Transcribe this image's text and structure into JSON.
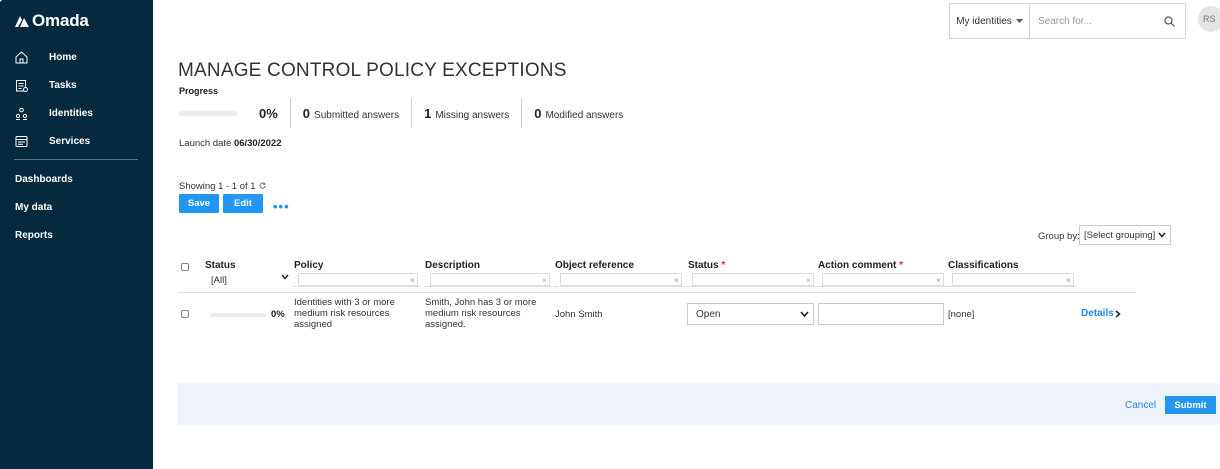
{
  "app": {
    "logo_text": "Omada"
  },
  "sidebar": {
    "items": [
      {
        "label": "Home",
        "icon": "home-icon"
      },
      {
        "label": "Tasks",
        "icon": "tasks-icon"
      },
      {
        "label": "Identities",
        "icon": "identities-icon"
      },
      {
        "label": "Services",
        "icon": "services-icon"
      }
    ],
    "links": [
      {
        "label": "Dashboards"
      },
      {
        "label": "My data"
      },
      {
        "label": "Reports"
      }
    ]
  },
  "topbar": {
    "identity_select": "My identities",
    "search_placeholder": "Search for...",
    "avatar_initials": "RS"
  },
  "page": {
    "title": "MANAGE CONTROL POLICY EXCEPTIONS",
    "progress_label": "Progress",
    "progress_percent_text": "0%",
    "progress_value": 0,
    "stats": [
      {
        "num": "0",
        "label": "Submitted answers"
      },
      {
        "num": "1",
        "label": "Missing answers"
      },
      {
        "num": "0",
        "label": "Modified answers"
      }
    ],
    "launch_label": "Launch date",
    "launch_date": "06/30/2022"
  },
  "toolbar": {
    "showing": "Showing 1 - 1 of 1",
    "save_label": "Save",
    "edit_label": "Edit",
    "more_label": "•••",
    "groupby_label": "Group by:",
    "groupby_value": "[Select grouping]"
  },
  "table": {
    "columns": [
      {
        "label": "Status",
        "required": false
      },
      {
        "label": "Policy",
        "required": false
      },
      {
        "label": "Description",
        "required": false
      },
      {
        "label": "Object reference",
        "required": false
      },
      {
        "label": "Status",
        "required": true
      },
      {
        "label": "Action comment",
        "required": true
      },
      {
        "label": "Classifications",
        "required": false
      }
    ],
    "status_filter": "[All]",
    "rows": [
      {
        "progress_text": "0%",
        "progress_value": 0,
        "policy": "Identities with 3 or more medium risk resources assigned",
        "description": "Smith, John has 3 or more medium risk resources assigned.",
        "object_reference": "John Smith",
        "status": "Open",
        "action_comment": "",
        "classifications": "[none]",
        "details_label": "Details"
      }
    ]
  },
  "footer": {
    "cancel_label": "Cancel",
    "submit_label": "Submit"
  },
  "colors": {
    "sidebar_bg": "#062a3d",
    "accent": "#2196f3",
    "link": "#1e88e5",
    "required": "#d0312d",
    "footer_bg": "#eff4fa"
  }
}
